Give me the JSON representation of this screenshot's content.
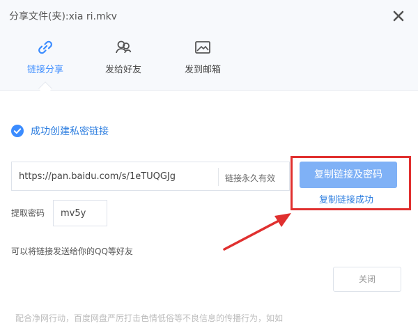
{
  "dialog": {
    "title": "分享文件(夹):xia ri.mkv"
  },
  "tabs": [
    {
      "label": "链接分享",
      "icon": "link-icon",
      "active": true
    },
    {
      "label": "发给好友",
      "icon": "friends-icon",
      "active": false
    },
    {
      "label": "发到邮箱",
      "icon": "mail-icon",
      "active": false
    }
  ],
  "status": {
    "message": "成功创建私密链接",
    "icon": "check-circle-icon"
  },
  "share": {
    "url": "https://pan.baidu.com/s/1eTUQGJg",
    "validity": "链接永久有效",
    "copy_button": "复制链接及密码",
    "copied_message": "复制链接成功"
  },
  "password": {
    "label": "提取密码",
    "value": "mv5y"
  },
  "hint": "可以将链接发送给你的QQ等好友",
  "close_button": "关闭",
  "footer_notice": "配合净网行动，百度网盘严厉打击色情低俗等不良信息的传播行为，如如",
  "colors": {
    "accent": "#3b8cff",
    "button_bg": "#7fb1f6",
    "annotation_red": "#e0302f"
  }
}
